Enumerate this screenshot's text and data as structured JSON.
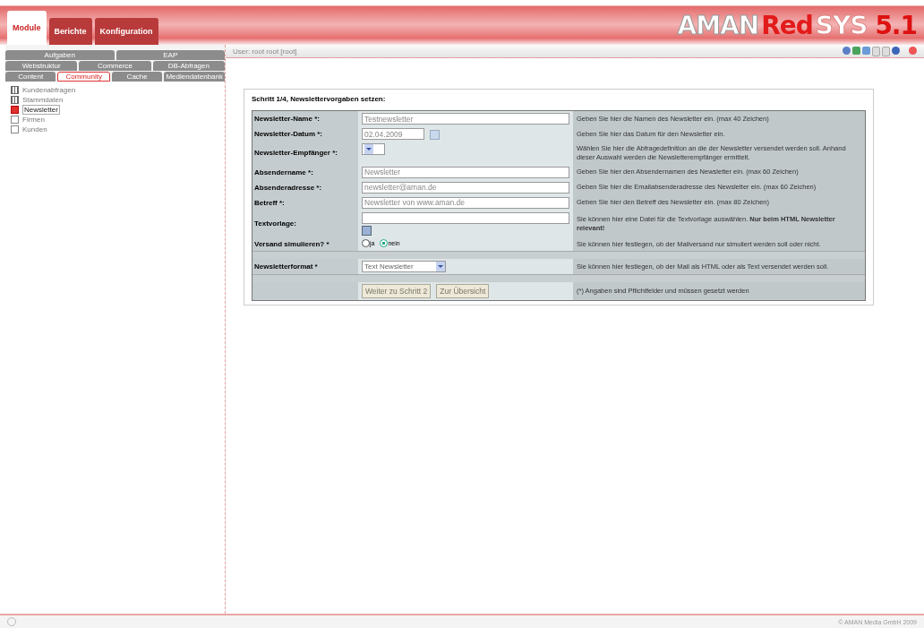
{
  "header": {
    "tabs": [
      {
        "label": "Module",
        "selected": true
      },
      {
        "label": "Berichte",
        "selected": false
      },
      {
        "label": "Konfiguration",
        "selected": false
      }
    ],
    "logo": {
      "part_1": "AMAN",
      "part_2": "Red",
      "part_3": "SYS",
      "version": "5.1"
    }
  },
  "sidebar": {
    "tab_rows": [
      [
        {
          "label": "Aufgaben",
          "selected": false
        },
        {
          "label": "EAP",
          "selected": false
        }
      ],
      [
        {
          "label": "Webstruktur",
          "selected": false
        },
        {
          "label": "Commerce",
          "selected": false
        },
        {
          "label": "DB-Abfragen",
          "selected": false
        }
      ],
      [
        {
          "label": "Content",
          "selected": false
        },
        {
          "label": "Community",
          "selected": true
        },
        {
          "label": "Cache",
          "selected": false
        },
        {
          "label": "Mediendatenbank",
          "selected": false
        }
      ]
    ],
    "items": [
      {
        "label": "Kundenabfragen",
        "kind": "group",
        "selected": false
      },
      {
        "label": "Stammdaten",
        "kind": "group",
        "selected": false
      },
      {
        "label": "Newsletter",
        "kind": "page",
        "selected": true
      },
      {
        "label": "Firmen",
        "kind": "page",
        "selected": false
      },
      {
        "label": "Kunden",
        "kind": "page",
        "selected": false
      }
    ]
  },
  "user_bar": {
    "text": "User: root root [root]"
  },
  "form": {
    "title": "Schritt 1/4, Newslettervorgaben setzen:",
    "sections": [
      [
        {
          "label": "Newsletter-Name *:",
          "kind": "text",
          "value": "Testnewsletter",
          "help": "Geben Sie hier die Namen des Newsletter ein. (max 40 Zeichen)"
        },
        {
          "label": "Newsletter-Datum *:",
          "kind": "date",
          "value": "02.04.2009",
          "help": "Geben Sie hier das Datum für den Newsletter ein."
        },
        {
          "label": "Newsletter-Empfänger *:",
          "kind": "select",
          "help": "Wählen Sie hier die Abfragedefinition an die der Newsletter versendet werden soll. Anhand dieser Auswahl werden die Newsletterempfänger ermittelt."
        },
        {
          "label": "Absendername *:",
          "kind": "text",
          "value": "Newsletter",
          "help": "Geben Sie hier den Absendernamen des Newsletter ein. (max 60 Zeichen)"
        },
        {
          "label": "Absenderadresse *:",
          "kind": "text",
          "value": "newsletter@aman.de",
          "help": "Geben Sie hier die Emailabsenderadresse des Newsletter ein. (max 60 Zeichen)"
        },
        {
          "label": "Betreff *:",
          "kind": "text",
          "value": "Newsletter von www.aman.de",
          "help": "Geben Sie hier den Betreff des Newsletter ein. (max 80 Zeichen)"
        },
        {
          "label": "Textvorlage:",
          "kind": "file",
          "help": "Sie können hier eine Datei für die Textvorlage auswählen. **Nur beim HTML Newsletter relevant!**"
        },
        {
          "label": "Versand simulieren? *",
          "kind": "radio",
          "options": [
            {
              "label": "ja",
              "selected": false
            },
            {
              "label": "nein",
              "selected": true
            }
          ],
          "help": "Sie können hier festlegen, ob der Mailversand nur simuliert werden soll oder nicht."
        }
      ],
      [
        {
          "label": "Newsletterformat *",
          "kind": "select",
          "value": "Text Newsletter",
          "help": "Sie können hier festlegen, ob der Mail als HTML oder als Text versendet werden soll."
        }
      ],
      [
        {
          "kind": "buttons",
          "buttons": [
            "Weiter zu Schritt 2",
            "Zur Übersicht"
          ],
          "help": "(*) Angaben sind Pflichtfelder und müssen gesetzt werden"
        }
      ]
    ]
  },
  "footer": {
    "copyright": "© AMAN Media GmbH 2009"
  }
}
